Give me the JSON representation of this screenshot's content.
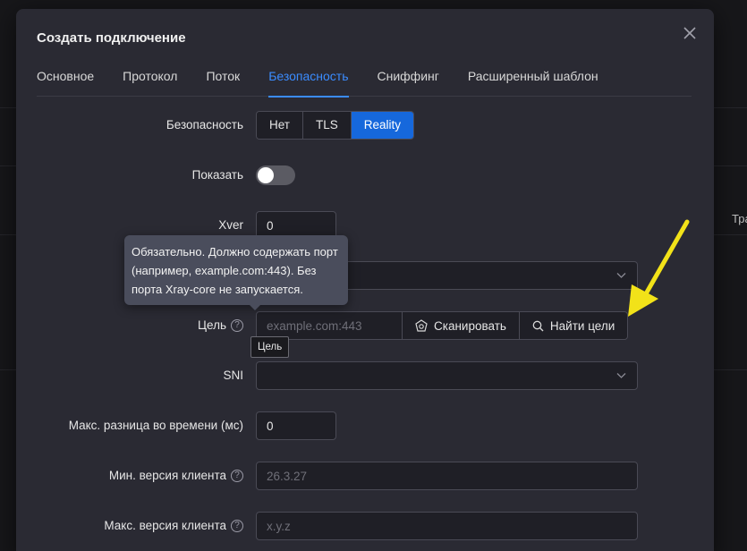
{
  "background": {
    "right_fragment": "Тра"
  },
  "modal": {
    "title": "Создать подключение",
    "tabs": [
      {
        "label": "Основное"
      },
      {
        "label": "Протокол"
      },
      {
        "label": "Поток"
      },
      {
        "label": "Безопасность",
        "active": true
      },
      {
        "label": "Сниффинг"
      },
      {
        "label": "Расширенный шаблон"
      }
    ]
  },
  "form": {
    "security": {
      "label": "Безопасность",
      "options": [
        "Нет",
        "TLS",
        "Reality"
      ],
      "selected": "Reality"
    },
    "show": {
      "label": "Показать",
      "enabled": false
    },
    "xver": {
      "label": "Xver",
      "value": "0"
    },
    "target": {
      "label": "Цель",
      "placeholder": "example.com:443",
      "scan_label": "Сканировать",
      "find_label": "Найти цели",
      "tooltip": "Обязательно. Должно содержать порт (например, example.com:443). Без порта Xray-core не запускается.",
      "hover_tip": "Цель"
    },
    "sni": {
      "label": "SNI"
    },
    "max_time_diff": {
      "label": "Макс. разница во времени (мс)",
      "value": "0"
    },
    "min_client_ver": {
      "label": "Мин. версия клиента",
      "placeholder": "26.3.27"
    },
    "max_client_ver": {
      "label": "Макс. версия клиента",
      "placeholder": "x.y.z"
    }
  },
  "colors": {
    "accent": "#1668dc",
    "tab_active": "#3b8cff",
    "annotation_arrow": "#f2e219"
  }
}
